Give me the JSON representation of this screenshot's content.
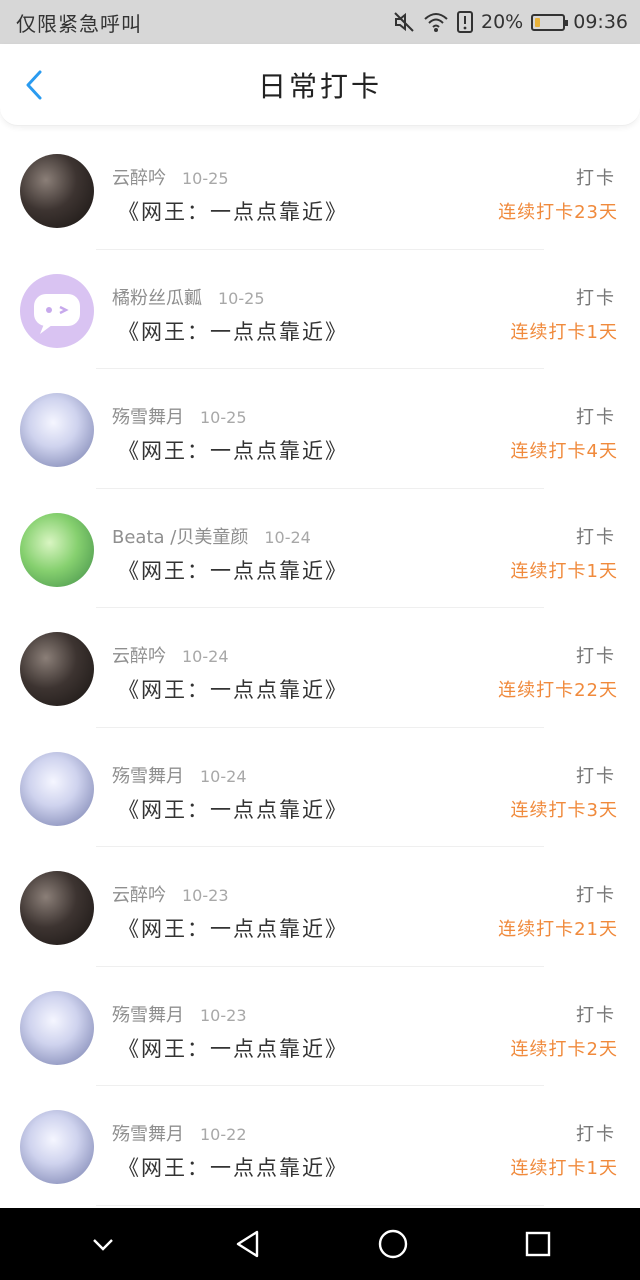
{
  "status_bar": {
    "carrier": "仅限紧急呼叫",
    "battery": "20%",
    "battery_level": 0.2,
    "time": "09:36",
    "icons": [
      "mute-icon",
      "wifi-icon",
      "sim-alert-icon",
      "battery-icon"
    ]
  },
  "header": {
    "title": "日常打卡",
    "back_icon": "back-chevron-icon",
    "accent_color": "#2a9bf0"
  },
  "records": [
    {
      "name": "云醉吟",
      "date": "10-25",
      "book": "《网王：一点点靠近》",
      "action": "打卡",
      "streak": "连续打卡23天",
      "avatar": "dark"
    },
    {
      "name": "橘粉丝瓜瓤",
      "date": "10-25",
      "book": "《网王：一点点靠近》",
      "action": "打卡",
      "streak": "连续打卡1天",
      "avatar": "lilac"
    },
    {
      "name": "殇雪舞月",
      "date": "10-25",
      "book": "《网王：一点点靠近》",
      "action": "打卡",
      "streak": "连续打卡4天",
      "avatar": "anime"
    },
    {
      "name": "Beata /贝美童颜",
      "date": "10-24",
      "book": "《网王：一点点靠近》",
      "action": "打卡",
      "streak": "连续打卡1天",
      "avatar": "green"
    },
    {
      "name": "云醉吟",
      "date": "10-24",
      "book": "《网王：一点点靠近》",
      "action": "打卡",
      "streak": "连续打卡22天",
      "avatar": "dark"
    },
    {
      "name": "殇雪舞月",
      "date": "10-24",
      "book": "《网王：一点点靠近》",
      "action": "打卡",
      "streak": "连续打卡3天",
      "avatar": "anime"
    },
    {
      "name": "云醉吟",
      "date": "10-23",
      "book": "《网王：一点点靠近》",
      "action": "打卡",
      "streak": "连续打卡21天",
      "avatar": "dark"
    },
    {
      "name": "殇雪舞月",
      "date": "10-23",
      "book": "《网王：一点点靠近》",
      "action": "打卡",
      "streak": "连续打卡2天",
      "avatar": "anime"
    },
    {
      "name": "殇雪舞月",
      "date": "10-22",
      "book": "《网王：一点点靠近》",
      "action": "打卡",
      "streak": "连续打卡1天",
      "avatar": "anime"
    }
  ],
  "nav_bar": {
    "buttons": [
      "collapse-down-icon",
      "back-triangle-icon",
      "home-circle-icon",
      "recents-square-icon"
    ]
  },
  "colors": {
    "streak": "#f08a3c",
    "status_bar_bg": "#d7d7d7",
    "nav_bar_bg": "#000000"
  }
}
